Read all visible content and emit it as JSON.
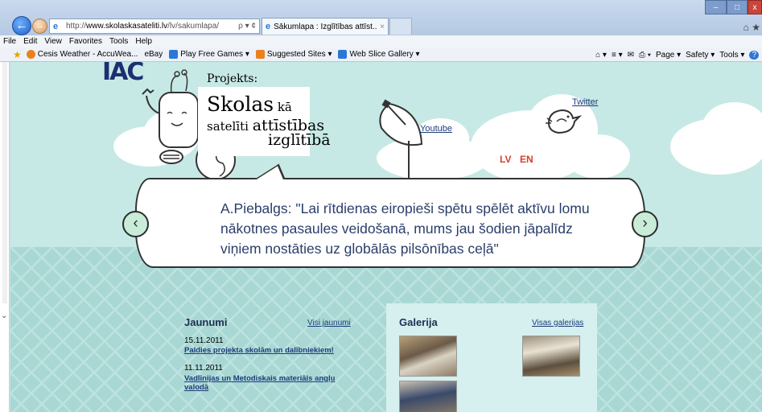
{
  "browser": {
    "url_host": "www.skolaskasateliti.lv",
    "url_prefix": "http://",
    "url_path": "/lv/sakumlapa/",
    "address_tools": "ρ ▾ ¢",
    "tab_title": "Sākumlapa : Izglītības attīst...",
    "tab_close": "×",
    "menu": [
      "File",
      "Edit",
      "View",
      "Favorites",
      "Tools",
      "Help"
    ],
    "favorites": [
      {
        "label": "Cesis Weather - AccuWea...",
        "color": "#e9821d"
      },
      {
        "label": "eBay",
        "color": ""
      },
      {
        "label": "Play Free Games ▾",
        "color": "#2b77d6"
      },
      {
        "label": "Suggested Sites ▾",
        "color": "#e9821d"
      },
      {
        "label": "Web Slice Gallery ▾",
        "color": "#2b77d6"
      }
    ],
    "commands": [
      "⌂ ▾",
      "≡ ▾",
      "✉",
      "⎙ ▾",
      "Page ▾",
      "Safety ▾",
      "Tools ▾",
      "?"
    ],
    "window_buttons": {
      "min": "–",
      "max": "□",
      "close": "x"
    },
    "home_icons": "⌂ ★"
  },
  "site": {
    "logo_top": "IAC",
    "projekts_label": "Projekts:",
    "title_line1_big": "Skolas",
    "title_line1_small": " kā",
    "title_line2_small": "satelīti ",
    "title_line2_big": "attīstības",
    "title_line3": "izglītībā",
    "youtube": "Youtube",
    "twitter": "Twitter",
    "lang_lv": "LV",
    "lang_en": "EN",
    "quote": "A.Piebalgs: \"Lai rītdienas eiropieši spētu spēlēt aktīvu lomu nākotnes pasaules veidošanā, mums jau šodien jāpalīdz viņiem nostāties uz globālās pilsōnības ceļā\"",
    "prev_arrow": "‹",
    "next_arrow": "›"
  },
  "news": {
    "title": "Jaunumi",
    "all_link": "Visi jaunumi",
    "items": [
      {
        "date": "15.11.2011",
        "title": "Paldies projekta skolām un dalībniekiem!"
      },
      {
        "date": "11.11.2011",
        "title": "Vadlīnijas un Metodiskais materiāls angļu valodā"
      }
    ]
  },
  "gallery": {
    "title": "Galerija",
    "all_link": "Visas galerijas"
  },
  "colors": {
    "sky": "#c6e9e5",
    "sea": "#a9d7d3",
    "link": "#1c3c7a",
    "lang": "#d5402b",
    "arrow_fill": "#c9ecd8"
  }
}
